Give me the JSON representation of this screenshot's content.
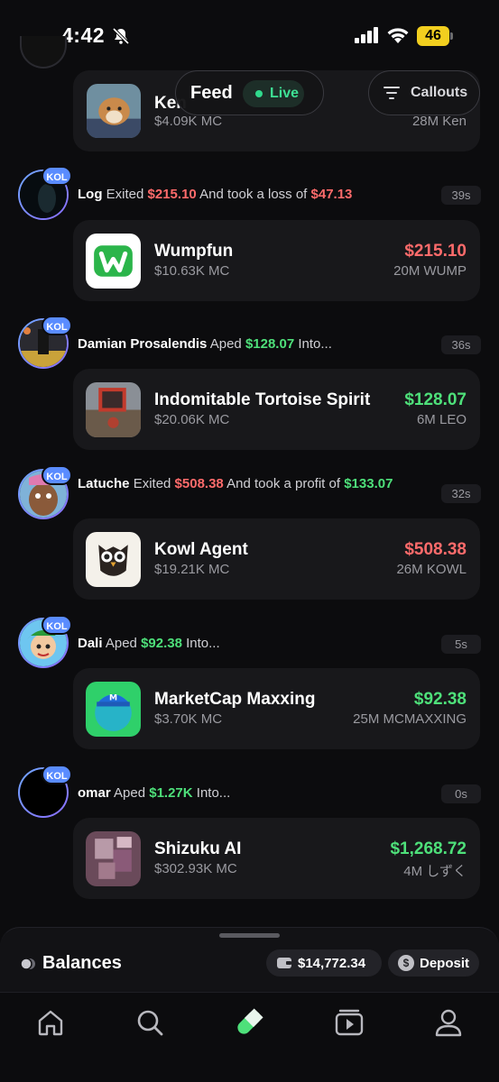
{
  "status_bar": {
    "time": "4:42",
    "battery": "46"
  },
  "header": {
    "feed_label": "Feed",
    "live_label": "Live",
    "callouts_label": "Callouts"
  },
  "top_card": {
    "name": "Ken",
    "mc": "$4.09K MC",
    "amount": "28M Ken"
  },
  "items": [
    {
      "user": "Log",
      "badge": "KOL",
      "time": "39s",
      "segments": [
        {
          "text": "Exited ",
          "style": "plain"
        },
        {
          "text": "$215.10",
          "style": "red"
        },
        {
          "text": " And took a loss of ",
          "style": "plain"
        },
        {
          "text": "$47.13",
          "style": "red"
        }
      ],
      "token": {
        "name": "Wumpfun",
        "mc": "$10.63K MC",
        "value": "$215.10",
        "value_color": "red",
        "amount": "20M WUMP"
      }
    },
    {
      "user": "Damian Prosalendis",
      "badge": "KOL",
      "time": "36s",
      "segments": [
        {
          "text": "Aped ",
          "style": "plain"
        },
        {
          "text": "$128.07",
          "style": "green"
        },
        {
          "text": " Into...",
          "style": "plain"
        }
      ],
      "token": {
        "name": "Indomitable Tortoise Spirit",
        "mc": "$20.06K MC",
        "value": "$128.07",
        "value_color": "green",
        "amount": "6M LEO"
      }
    },
    {
      "user": "Latuche",
      "badge": "KOL",
      "time": "32s",
      "segments": [
        {
          "text": "Exited ",
          "style": "plain"
        },
        {
          "text": "$508.38",
          "style": "red"
        },
        {
          "text": " And took a profit of ",
          "style": "plain"
        },
        {
          "text": "$133.07",
          "style": "green"
        }
      ],
      "token": {
        "name": "Kowl Agent",
        "mc": "$19.21K MC",
        "value": "$508.38",
        "value_color": "red",
        "amount": "26M KOWL"
      }
    },
    {
      "user": "Dali",
      "badge": "KOL",
      "time": "5s",
      "segments": [
        {
          "text": "Aped ",
          "style": "plain"
        },
        {
          "text": "$92.38",
          "style": "green"
        },
        {
          "text": " Into...",
          "style": "plain"
        }
      ],
      "token": {
        "name": "MarketCap Maxxing",
        "mc": "$3.70K MC",
        "value": "$92.38",
        "value_color": "green",
        "amount": "25M MCMAXXING"
      }
    },
    {
      "user": "omar",
      "badge": "KOL",
      "time": "0s",
      "segments": [
        {
          "text": "Aped ",
          "style": "plain"
        },
        {
          "text": "$1.27K",
          "style": "green"
        },
        {
          "text": " Into...",
          "style": "plain"
        }
      ],
      "token": {
        "name": "Shizuku AI",
        "mc": "$302.93K MC",
        "value": "$1,268.72",
        "value_color": "green",
        "amount": "4M しずく"
      }
    }
  ],
  "balances": {
    "title": "Balances",
    "total": "$14,772.34",
    "deposit_label": "Deposit"
  },
  "tabbar": {
    "tabs": [
      "home-icon",
      "search-icon",
      "pill-icon",
      "video-icon",
      "profile-icon"
    ]
  },
  "colors": {
    "green": "#4ee07a",
    "red": "#ff6b6b",
    "kol_badge": "#5a8cff",
    "live": "#3ee195"
  }
}
